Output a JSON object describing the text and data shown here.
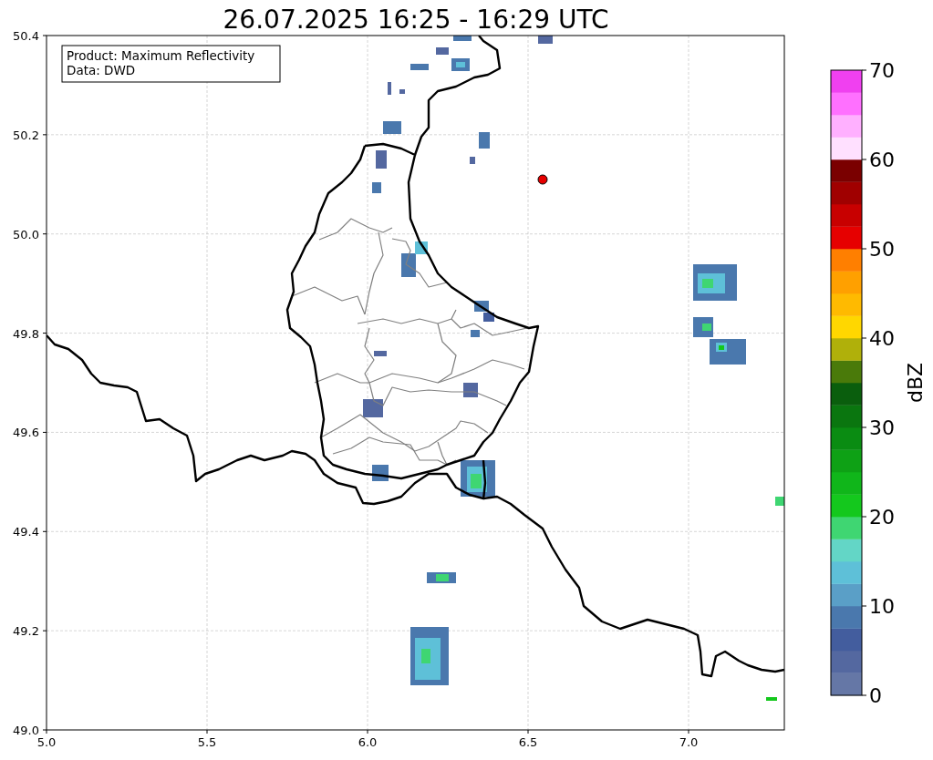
{
  "title": "26.07.2025 16:25 - 16:29 UTC",
  "info_box": {
    "lines": [
      "Product: Maximum Reflectivity",
      "Data: DWD"
    ]
  },
  "x_ticks": [
    "5.0",
    "5.5",
    "6.0",
    "6.5",
    "7.0"
  ],
  "y_ticks": [
    "50.4",
    "50.2",
    "50.0",
    "49.8",
    "49.6",
    "49.4",
    "49.2",
    "49.0"
  ],
  "colorbar": {
    "label": "dBZ",
    "ticks": [
      "70",
      "60",
      "50",
      "40",
      "30",
      "20",
      "10",
      "0"
    ],
    "bands": [
      {
        "color": "#6577a6"
      },
      {
        "color": "#5468a0"
      },
      {
        "color": "#435d9e"
      },
      {
        "color": "#4a78ad"
      },
      {
        "color": "#5a9fc7"
      },
      {
        "color": "#5ec0d8"
      },
      {
        "color": "#63d6c6"
      },
      {
        "color": "#3fd672"
      },
      {
        "color": "#14c81d"
      },
      {
        "color": "#10b61a"
      },
      {
        "color": "#0ea115"
      },
      {
        "color": "#0a8c12"
      },
      {
        "color": "#0a760f"
      },
      {
        "color": "#0a5e0d"
      },
      {
        "color": "#4a7a0a"
      },
      {
        "color": "#b0b00a"
      },
      {
        "color": "#ffd700"
      },
      {
        "color": "#ffba00"
      },
      {
        "color": "#ffa000"
      },
      {
        "color": "#ff7f00"
      },
      {
        "color": "#e60000"
      },
      {
        "color": "#c80000"
      },
      {
        "color": "#a00000"
      },
      {
        "color": "#7a0000"
      },
      {
        "color": "#ffe0ff"
      },
      {
        "color": "#ffb0ff"
      },
      {
        "color": "#ff70ff"
      },
      {
        "color": "#f040f0"
      }
    ]
  }
}
